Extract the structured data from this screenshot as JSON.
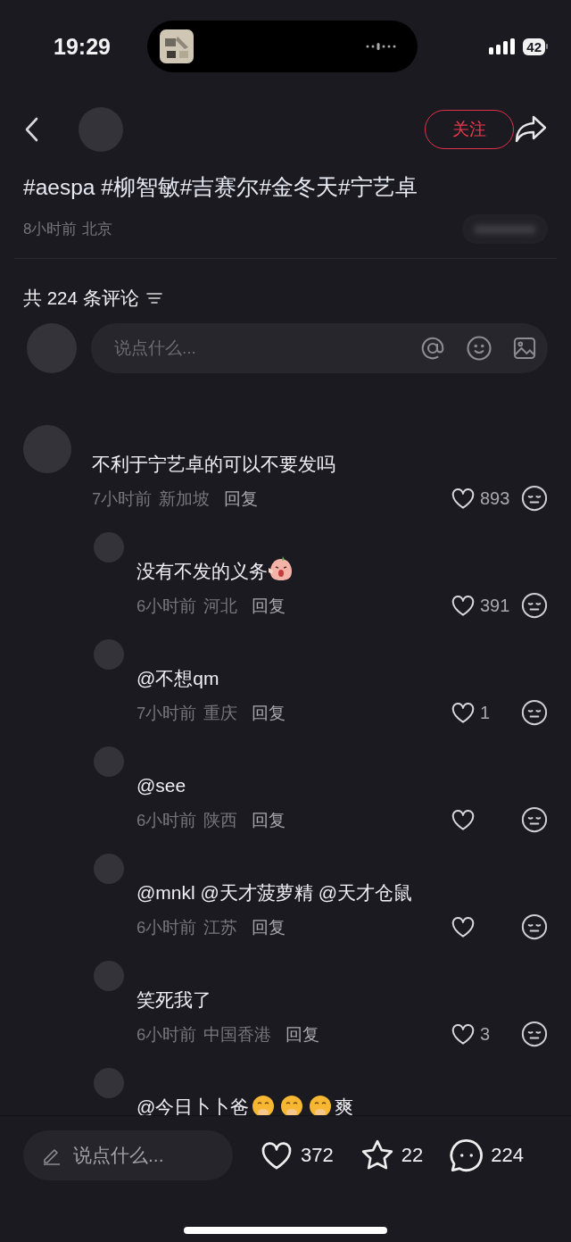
{
  "status_bar": {
    "time": "19:29",
    "battery": "42"
  },
  "header": {
    "follow_button": "关注"
  },
  "post": {
    "hashtags": "#aespa #柳智敏#吉赛尔#金冬天#宁艺卓",
    "time": "8小时前",
    "location": "北京"
  },
  "comments_header": {
    "title": "共 224 条评论"
  },
  "comment_input": {
    "placeholder": "说点什么..."
  },
  "comments": [
    {
      "parts": [
        {
          "kind": "text",
          "text": "不利于宁艺卓的可以不要发吗"
        }
      ],
      "time": "7小时前",
      "location": "新加坡",
      "reply": "回复",
      "likes": "893",
      "liked": false,
      "children": [
        {
          "parts": [
            {
              "kind": "text",
              "text": "没有不发的义务"
            },
            {
              "kind": "sticker"
            }
          ],
          "time": "6小时前",
          "location": "河北",
          "reply": "回复",
          "likes": "391",
          "liked": false
        },
        {
          "parts": [
            {
              "kind": "text",
              "text": "@不想qm"
            }
          ],
          "time": "7小时前",
          "location": "重庆",
          "reply": "回复",
          "likes": "1",
          "liked": false
        },
        {
          "parts": [
            {
              "kind": "text",
              "text": "@see"
            }
          ],
          "time": "6小时前",
          "location": "陕西",
          "reply": "回复",
          "liked": false
        },
        {
          "parts": [
            {
              "kind": "text",
              "text": "@mnkl @天才菠萝精 @天才仓鼠"
            }
          ],
          "time": "6小时前",
          "location": "江苏",
          "reply": "回复",
          "liked": false
        },
        {
          "parts": [
            {
              "kind": "text",
              "text": "笑死我了"
            }
          ],
          "time": "6小时前",
          "location": "中国香港",
          "reply": "回复",
          "likes": "3",
          "liked": false
        },
        {
          "parts": [
            {
              "kind": "text",
              "text": "@今日卜卜爸"
            },
            {
              "kind": "emoji"
            },
            {
              "kind": "emoji"
            },
            {
              "kind": "emoji"
            },
            {
              "kind": "text",
              "text": "爽"
            }
          ]
        }
      ]
    }
  ],
  "bottom_bar": {
    "placeholder": "说点什么...",
    "likes": "372",
    "favorites": "22",
    "comments": "224"
  }
}
